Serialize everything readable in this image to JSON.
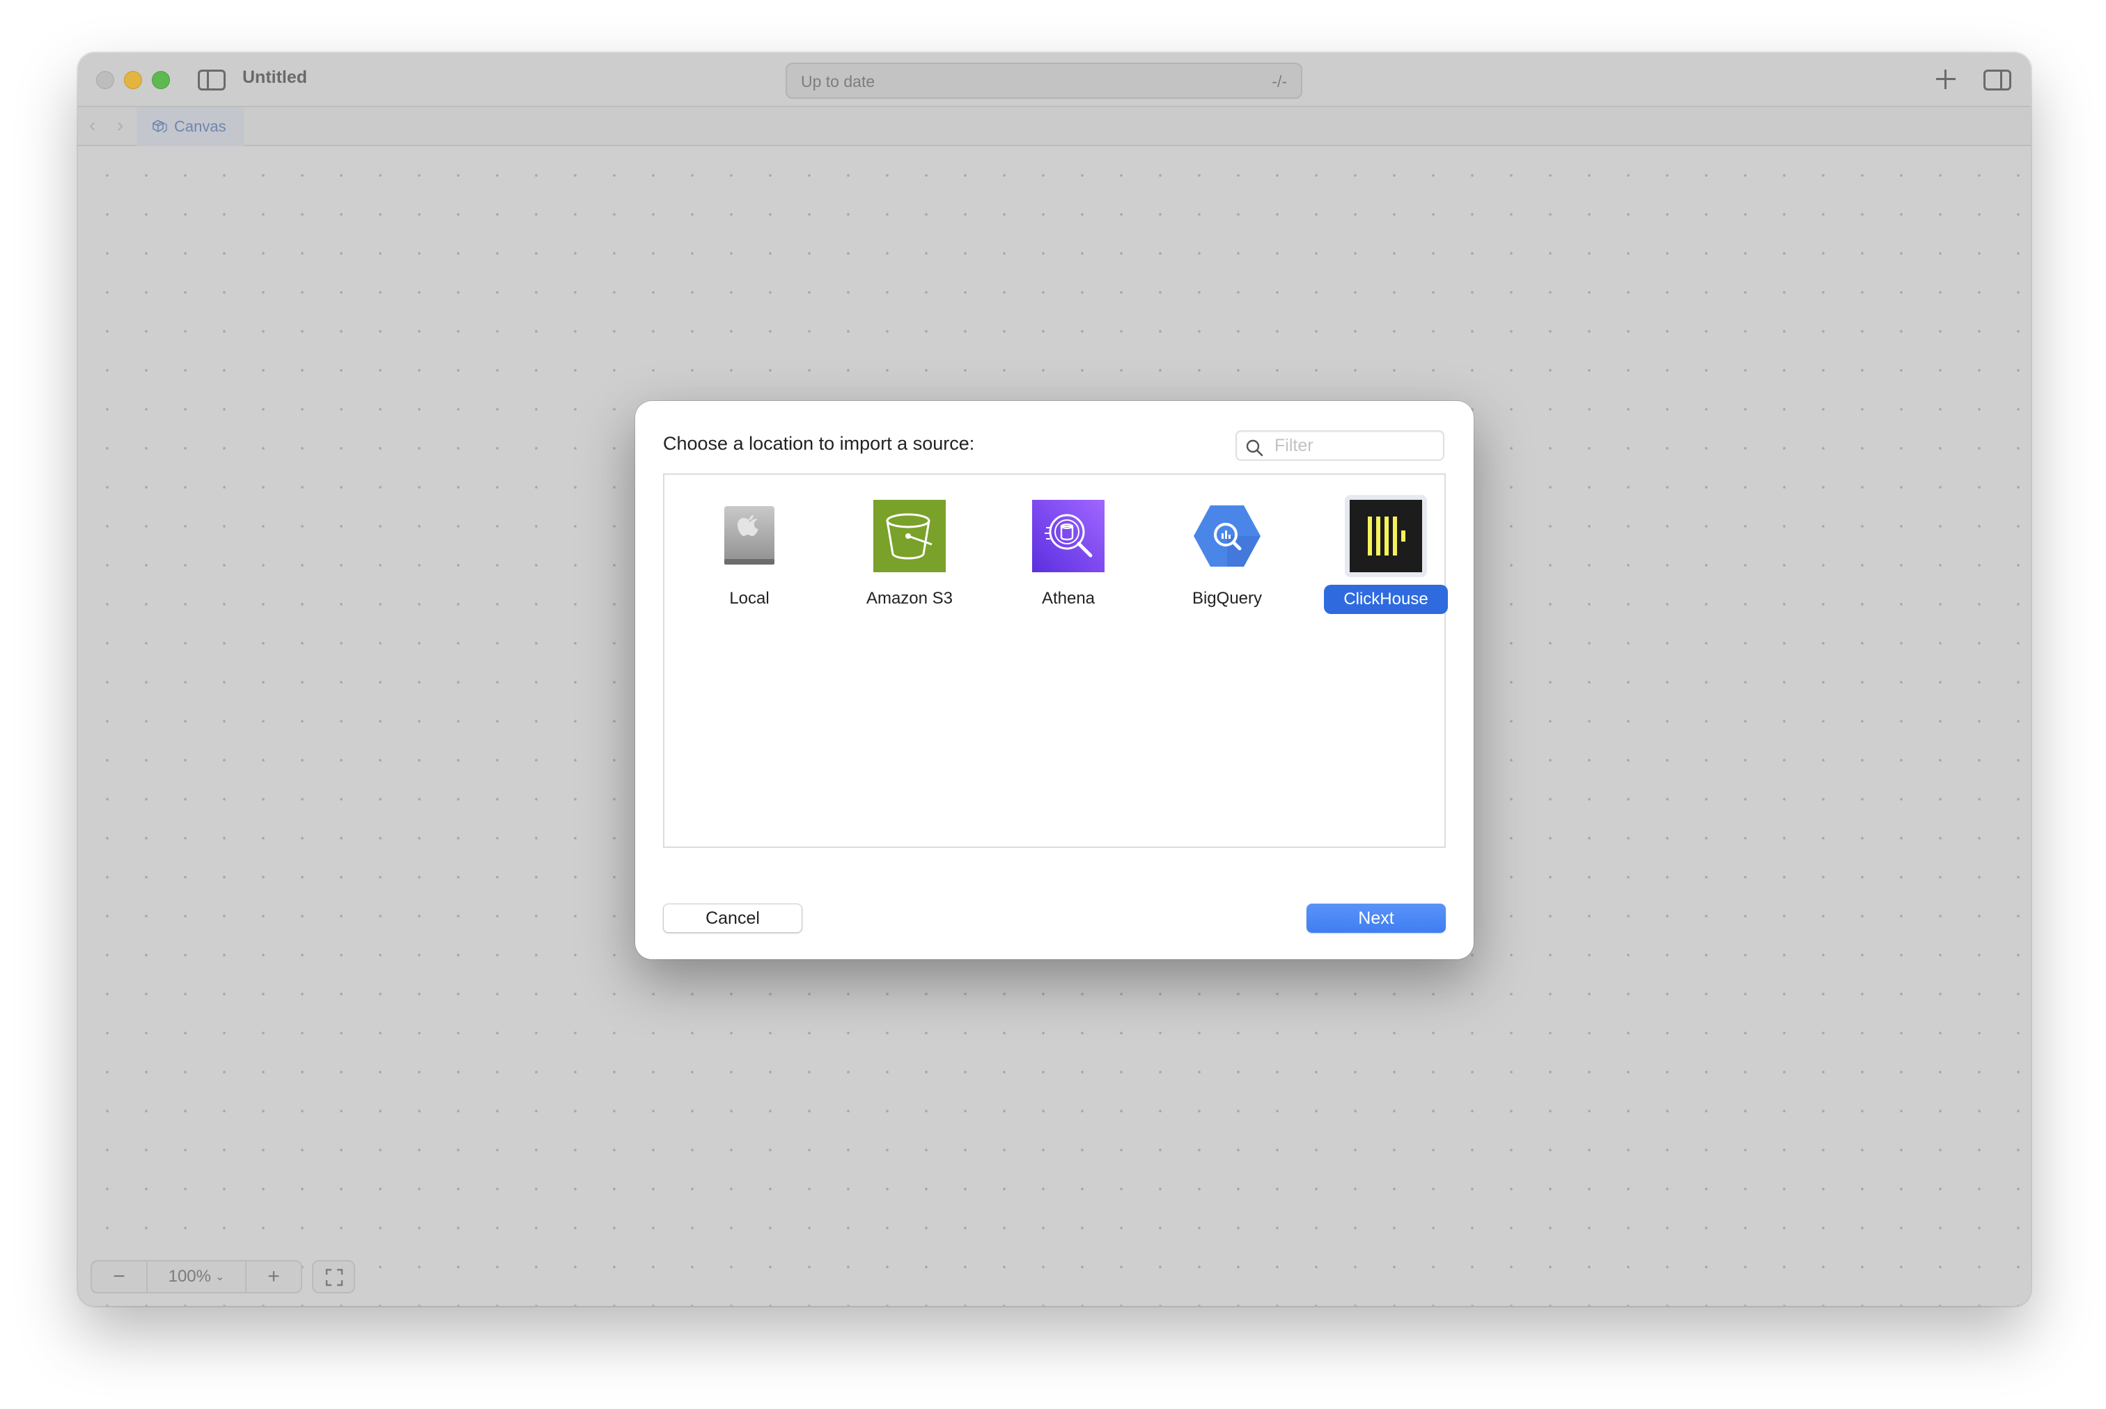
{
  "window": {
    "title": "Untitled",
    "status": "Up to date",
    "status_counter": "-/-"
  },
  "tabs": [
    {
      "label": "Canvas",
      "icon": "canvas-cube-icon"
    }
  ],
  "zoom": {
    "level": "100%",
    "decrease": "−",
    "increase": "+"
  },
  "dialog": {
    "title": "Choose a location to import a source:",
    "filter_placeholder": "Filter",
    "sources": [
      {
        "label": "Local",
        "icon": "local-drive-icon",
        "color": "#9a9a9a",
        "selected": false
      },
      {
        "label": "Amazon S3",
        "icon": "amazon-s3-bucket-icon",
        "color": "#7aa12a",
        "selected": false
      },
      {
        "label": "Athena",
        "icon": "athena-search-icon",
        "color": "#8c4fff",
        "selected": false
      },
      {
        "label": "BigQuery",
        "icon": "bigquery-icon",
        "color": "#4a86e8",
        "selected": false
      },
      {
        "label": "ClickHouse",
        "icon": "clickhouse-icon",
        "color": "#1c1c1c",
        "selected": true
      }
    ],
    "cancel_label": "Cancel",
    "next_label": "Next"
  },
  "colors": {
    "accent": "#2f6bde",
    "next_button": "#4a86f4",
    "clickhouse_bars": "#f5f25a"
  }
}
